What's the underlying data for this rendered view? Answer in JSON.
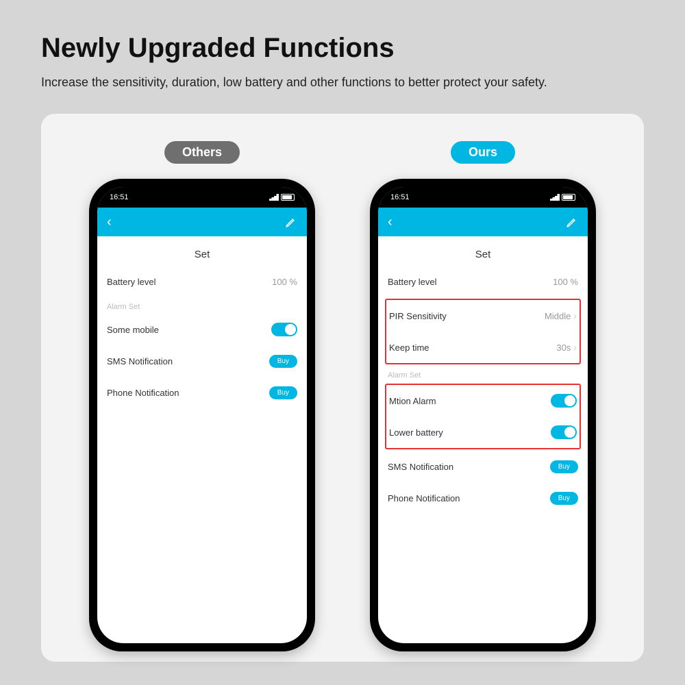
{
  "header": {
    "title": "Newly Upgraded Functions",
    "subtitle": "Increase the sensitivity, duration, low battery and other functions to better protect your safety."
  },
  "badges": {
    "others": "Others",
    "ours": "Ours"
  },
  "status": {
    "time": "16:51"
  },
  "screen_title": "Set",
  "common": {
    "battery_label": "Battery level",
    "battery_value": "100 %",
    "alarm_set": "Alarm Set",
    "sms": "SMS Notification",
    "phone": "Phone Notification",
    "buy": "Buy"
  },
  "others": {
    "some_mobile": "Some mobile"
  },
  "ours": {
    "pir_label": "PIR Sensitivity",
    "pir_value": "Middle",
    "keep_label": "Keep time",
    "keep_value": "30s",
    "motion": "Mtion Alarm",
    "lowbatt": "Lower battery"
  }
}
